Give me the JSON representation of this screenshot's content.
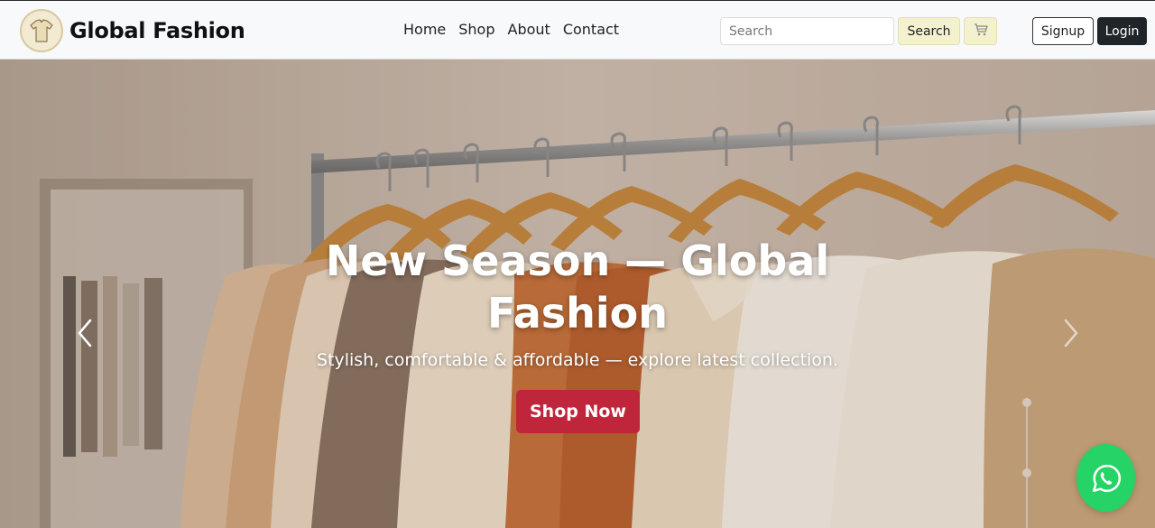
{
  "brand": {
    "name": "Global Fashion",
    "logo_icon": "shirt-icon"
  },
  "nav": {
    "links": [
      {
        "label": "Home"
      },
      {
        "label": "Shop"
      },
      {
        "label": "About"
      },
      {
        "label": "Contact"
      }
    ]
  },
  "search": {
    "placeholder": "Search",
    "value": "",
    "button_label": "Search"
  },
  "cart": {
    "icon": "cart-icon"
  },
  "auth": {
    "signup_label": "Signup",
    "login_label": "Login"
  },
  "hero": {
    "title": "New Season — Global Fashion",
    "subtitle": "Stylish, comfortable & affordable — explore latest collection.",
    "cta_label": "Shop Now",
    "prev_icon": "chevron-left-icon",
    "next_icon": "chevron-right-icon"
  },
  "whatsapp": {
    "icon": "whatsapp-icon"
  },
  "colors": {
    "navbar_bg": "#f8f9fa",
    "search_btn_bg": "#f4f1cf",
    "login_bg": "#1f2529",
    "cta_bg": "#c0263b",
    "whatsapp_bg": "#25d366"
  }
}
